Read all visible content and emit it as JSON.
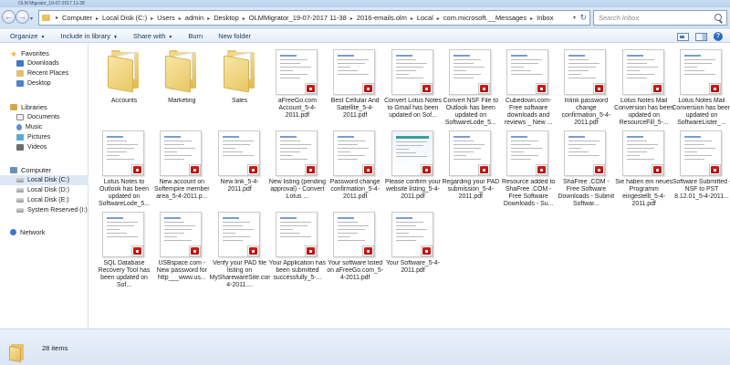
{
  "window": {
    "title": "OLM Migrator_19-07-2017 11-38"
  },
  "address": {
    "crumbs": [
      "Computer",
      "Local Disk (C:)",
      "Users",
      "admin",
      "Desktop",
      "OLMMigrator_19-07-2017 11-38",
      "2016-emails.olm",
      "Local",
      "com.microsoft.__Messages",
      "Inbox"
    ]
  },
  "search": {
    "placeholder": "Search Inbox"
  },
  "toolbar": {
    "organize": "Organize",
    "include": "Include in library",
    "share": "Share with",
    "burn": "Burn",
    "new_folder": "New folder"
  },
  "nav": {
    "favorites": "Favorites",
    "favorites_items": [
      "Downloads",
      "Recent Places",
      "Desktop"
    ],
    "libraries": "Libraries",
    "library_items": [
      "Documents",
      "Music",
      "Pictures",
      "Videos"
    ],
    "computer": "Computer",
    "computer_items": [
      "Local Disk (C:)",
      "Local Disk (D:)",
      "Local Disk (E:)",
      "System Reserved (I:)"
    ],
    "network": "Network"
  },
  "files": [
    {
      "name": "Accounts",
      "kind": "folder"
    },
    {
      "name": "Marketing",
      "kind": "folder"
    },
    {
      "name": "Sales",
      "kind": "folder"
    },
    {
      "name": "aFreeGo.com Account_5-4-2011.pdf",
      "kind": "pdf"
    },
    {
      "name": "Best Cellular And Satellite_5-4-2011.pdf",
      "kind": "pdf"
    },
    {
      "name": "Convert Lotus Notes to Gmail has been updated on Sof...",
      "kind": "pdf"
    },
    {
      "name": "Convert NSF File to Outlook has been updated on SoftwareLode_5...",
      "kind": "pdf"
    },
    {
      "name": "Cubedown.com- Free software downloads and reviews _ New ...",
      "kind": "pdf"
    },
    {
      "name": "Inlink password change confirmation_5-4-2011.pdf",
      "kind": "pdf"
    },
    {
      "name": "Lotus Notes Mail Conversion has been updated on ResourceFill_5-...",
      "kind": "pdf"
    },
    {
      "name": "Lotus Notes Mail Conversion has been updated on SoftwareLister_...",
      "kind": "pdf"
    },
    {
      "name": "Lotus Notes to Outlook has been updated on SoftwareLode_5...",
      "kind": "pdf"
    },
    {
      "name": "New account on Softempire member area_5-4-2011.p...",
      "kind": "pdf"
    },
    {
      "name": "New link_5-4-2011.pdf",
      "kind": "pdf"
    },
    {
      "name": "New listing (pending approval) - Convert Lotus ...",
      "kind": "pdf"
    },
    {
      "name": "Password change confirmation_5-4-2011.pdf",
      "kind": "pdf"
    },
    {
      "name": "Please confirm your website listing_5-4-2011.pdf",
      "kind": "pdf",
      "web": true
    },
    {
      "name": "Regarding your PAD submission_5-4-2011.pdf",
      "kind": "pdf"
    },
    {
      "name": "Resource added to ShaFree .COM - Free Software Downloads - Su...",
      "kind": "pdf"
    },
    {
      "name": "ShaFree .COM - Free Software Downloads - Submit Softwar...",
      "kind": "pdf"
    },
    {
      "name": "Sie haben ein neues Programm eingestellt_5-4-2011.pdf",
      "kind": "pdf"
    },
    {
      "name": "Software Submitted - NSF to PST 8.12.01_5-4-2011...",
      "kind": "pdf"
    },
    {
      "name": "SQL Database Recovery Tool has been updated on Sof...",
      "kind": "pdf"
    },
    {
      "name": "USBspace.com - New password for http___www.us...",
      "kind": "pdf"
    },
    {
      "name": "Verify your PAD file listing on MySharewareSite.com_5-4-2011....",
      "kind": "pdf"
    },
    {
      "name": "Your Application has been submitted successfully_5-...",
      "kind": "pdf"
    },
    {
      "name": "Your software listed on aFreeGo.com_5-4-2011.pdf",
      "kind": "pdf"
    },
    {
      "name": "Your Software_5-4-2011.pdf",
      "kind": "pdf"
    }
  ],
  "status": {
    "count": "28 items"
  }
}
